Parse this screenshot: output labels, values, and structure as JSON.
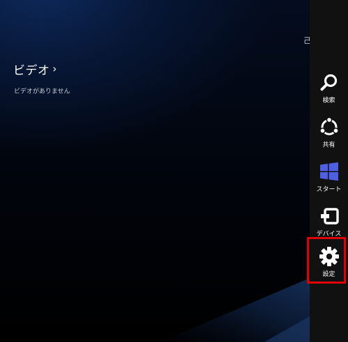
{
  "app": {
    "section_title": "ビデオ",
    "chevron": "›",
    "empty_message": "ビデオがありません",
    "clipped_text": "己"
  },
  "charms": {
    "search": {
      "label": "検索",
      "icon": "search-icon"
    },
    "share": {
      "label": "共有",
      "icon": "share-icon"
    },
    "start": {
      "label": "スタート",
      "icon": "windows-logo-icon",
      "color": "#4f5fe3"
    },
    "devices": {
      "label": "デバイス",
      "icon": "devices-icon"
    },
    "settings": {
      "label": "設定",
      "icon": "gear-icon",
      "highlighted": true,
      "highlight_color": "#e00000"
    }
  },
  "colors": {
    "charms_bar": "#111111",
    "background": "#000000",
    "accent_blue": "#4f5fe3"
  }
}
